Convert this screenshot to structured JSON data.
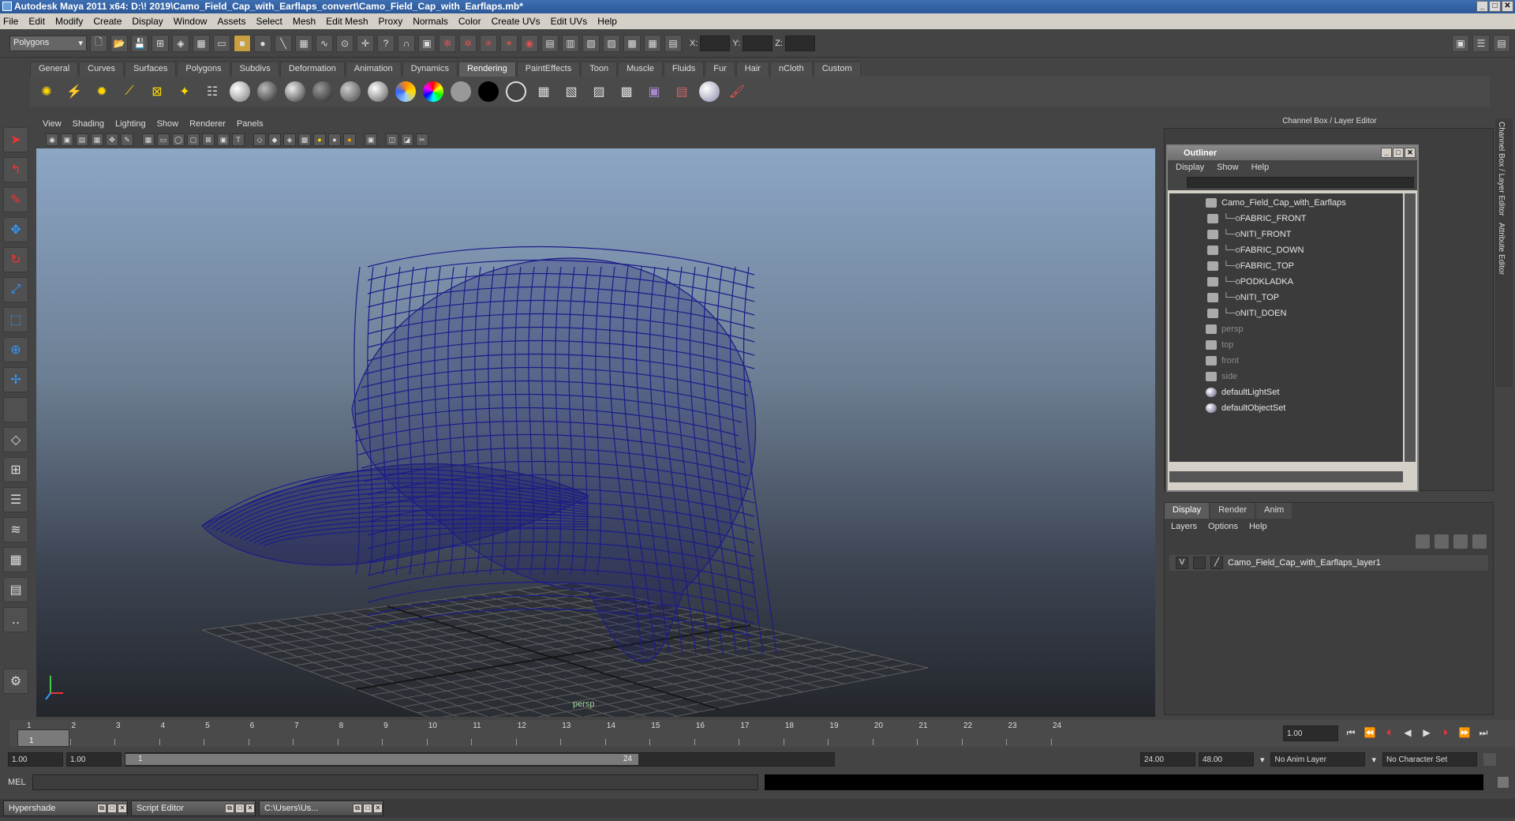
{
  "title": "Autodesk Maya 2011 x64: D:\\! 2019\\Camo_Field_Cap_with_Earflaps_convert\\Camo_Field_Cap_with_Earflaps.mb*",
  "menu": [
    "File",
    "Edit",
    "Modify",
    "Create",
    "Display",
    "Window",
    "Assets",
    "Select",
    "Mesh",
    "Edit Mesh",
    "Proxy",
    "Normals",
    "Color",
    "Create UVs",
    "Edit UVs",
    "Help"
  ],
  "mode_select": "Polygons",
  "xyz": {
    "x": "X:",
    "y": "Y:",
    "z": "Z:"
  },
  "shelf_tabs": [
    "General",
    "Curves",
    "Surfaces",
    "Polygons",
    "Subdivs",
    "Deformation",
    "Animation",
    "Dynamics",
    "Rendering",
    "PaintEffects",
    "Toon",
    "Muscle",
    "Fluids",
    "Fur",
    "Hair",
    "nCloth",
    "Custom"
  ],
  "active_shelf": "Rendering",
  "viewport_menu": [
    "View",
    "Shading",
    "Lighting",
    "Show",
    "Renderer",
    "Panels"
  ],
  "viewport_label": "persp",
  "channel_box_title": "Channel Box / Layer Editor",
  "side_tabs": [
    "Channel Box / Layer Editor",
    "Attribute Editor"
  ],
  "outliner": {
    "title": "Outliner",
    "menu": [
      "Display",
      "Show",
      "Help"
    ],
    "items": [
      {
        "label": "Camo_Field_Cap_with_Earflaps",
        "indent": 0,
        "dim": false
      },
      {
        "label": "FABRIC_FRONT",
        "indent": 1,
        "dim": false
      },
      {
        "label": "NITI_FRONT",
        "indent": 1,
        "dim": false
      },
      {
        "label": "FABRIC_DOWN",
        "indent": 1,
        "dim": false
      },
      {
        "label": "FABRIC_TOP",
        "indent": 1,
        "dim": false
      },
      {
        "label": "PODKLADKA",
        "indent": 1,
        "dim": false
      },
      {
        "label": "NITI_TOP",
        "indent": 1,
        "dim": false
      },
      {
        "label": "NITI_DOEN",
        "indent": 1,
        "dim": false
      },
      {
        "label": "persp",
        "indent": 0,
        "dim": true
      },
      {
        "label": "top",
        "indent": 0,
        "dim": true
      },
      {
        "label": "front",
        "indent": 0,
        "dim": true
      },
      {
        "label": "side",
        "indent": 0,
        "dim": true
      },
      {
        "label": "defaultLightSet",
        "indent": 0,
        "dim": false
      },
      {
        "label": "defaultObjectSet",
        "indent": 0,
        "dim": false
      }
    ]
  },
  "layer_editor": {
    "tabs": [
      "Display",
      "Render",
      "Anim"
    ],
    "menu": [
      "Layers",
      "Options",
      "Help"
    ],
    "layer_visible": "V",
    "layer_name": "Camo_Field_Cap_with_Earflaps_layer1"
  },
  "timeline": {
    "ticks": [
      "1",
      "2",
      "3",
      "4",
      "5",
      "6",
      "7",
      "8",
      "9",
      "10",
      "11",
      "12",
      "13",
      "14",
      "15",
      "16",
      "17",
      "18",
      "19",
      "20",
      "21",
      "22",
      "23",
      "24"
    ],
    "current_frame": "1",
    "current_time": "1.00"
  },
  "range": {
    "start": "1.00",
    "start2": "1.00",
    "slider_start": "1",
    "slider_end": "24",
    "end": "24.00",
    "end2": "48.00",
    "anim_layer": "No Anim Layer",
    "char_set": "No Character Set"
  },
  "cmd_label": "MEL",
  "taskbar": [
    "Hypershade",
    "Script Editor",
    "C:\\Users\\Us..."
  ],
  "colors": {
    "wire": "#1b1b8a",
    "viewport_top": "#8ca6c5",
    "viewport_bottom": "#23262b"
  }
}
